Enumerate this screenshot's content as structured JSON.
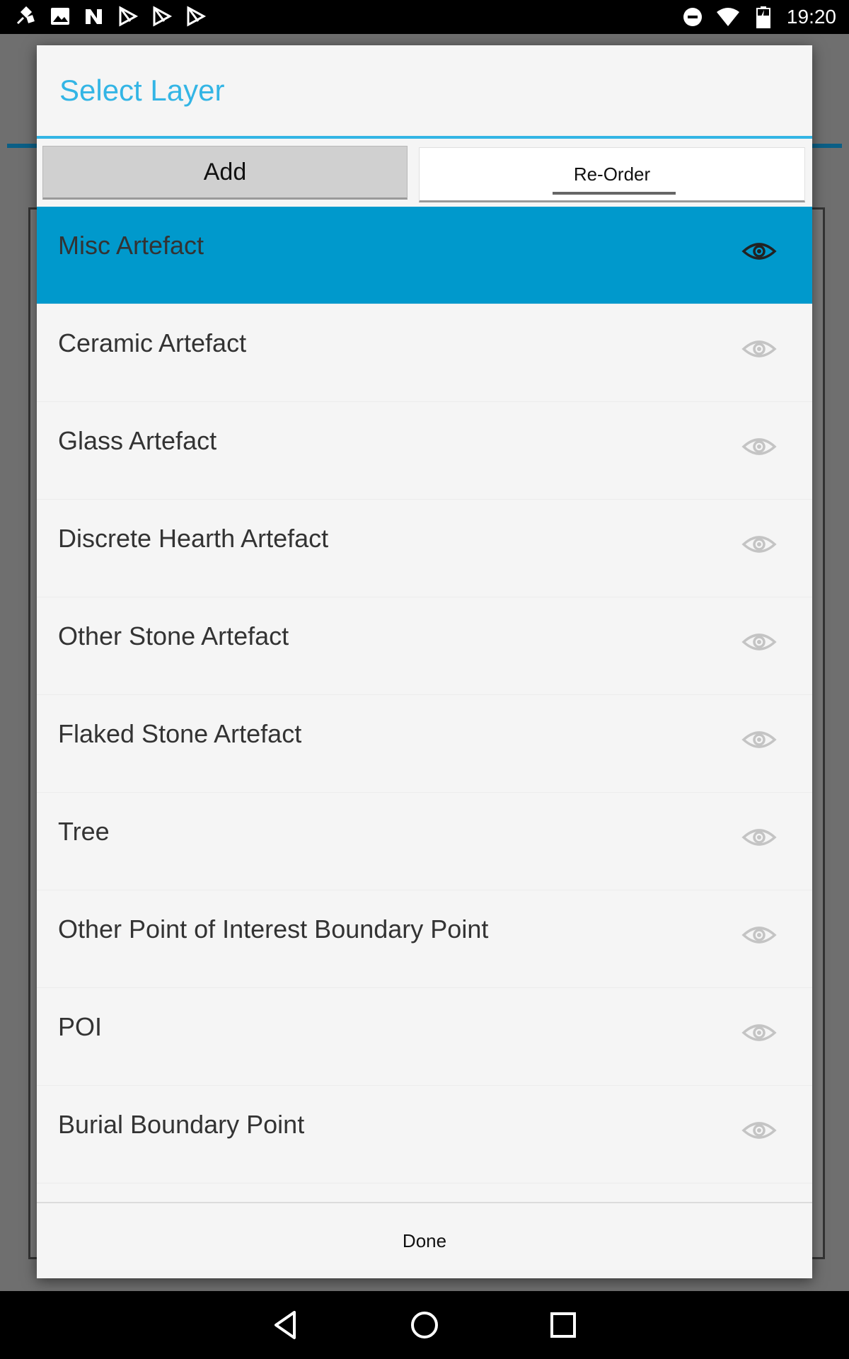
{
  "status_bar": {
    "time": "19:20",
    "left_icons": [
      "satellite-icon",
      "image-icon",
      "n-app-icon",
      "play-store-icon",
      "play-store-icon",
      "play-store-icon"
    ],
    "right_icons": [
      "do-not-disturb-icon",
      "wifi-icon",
      "battery-charging-icon"
    ]
  },
  "dialog": {
    "title": "Select Layer",
    "add_label": "Add",
    "reorder_label": "Re-Order",
    "done_label": "Done",
    "accent_color": "#33b5e5",
    "selected_color": "#0099cc",
    "items": [
      {
        "label": "Misc Artefact",
        "selected": true,
        "visible": true
      },
      {
        "label": "Ceramic Artefact",
        "selected": false,
        "visible": false
      },
      {
        "label": "Glass Artefact",
        "selected": false,
        "visible": false
      },
      {
        "label": "Discrete Hearth Artefact",
        "selected": false,
        "visible": false
      },
      {
        "label": "Other Stone Artefact",
        "selected": false,
        "visible": false
      },
      {
        "label": "Flaked Stone Artefact",
        "selected": false,
        "visible": false
      },
      {
        "label": "Tree",
        "selected": false,
        "visible": false
      },
      {
        "label": "Other Point of Interest Boundary Point",
        "selected": false,
        "visible": false
      },
      {
        "label": "POI",
        "selected": false,
        "visible": false
      },
      {
        "label": "Burial Boundary Point",
        "selected": false,
        "visible": false
      }
    ]
  },
  "nav_bar": {
    "buttons": [
      "back-icon",
      "home-icon",
      "recents-icon"
    ]
  }
}
